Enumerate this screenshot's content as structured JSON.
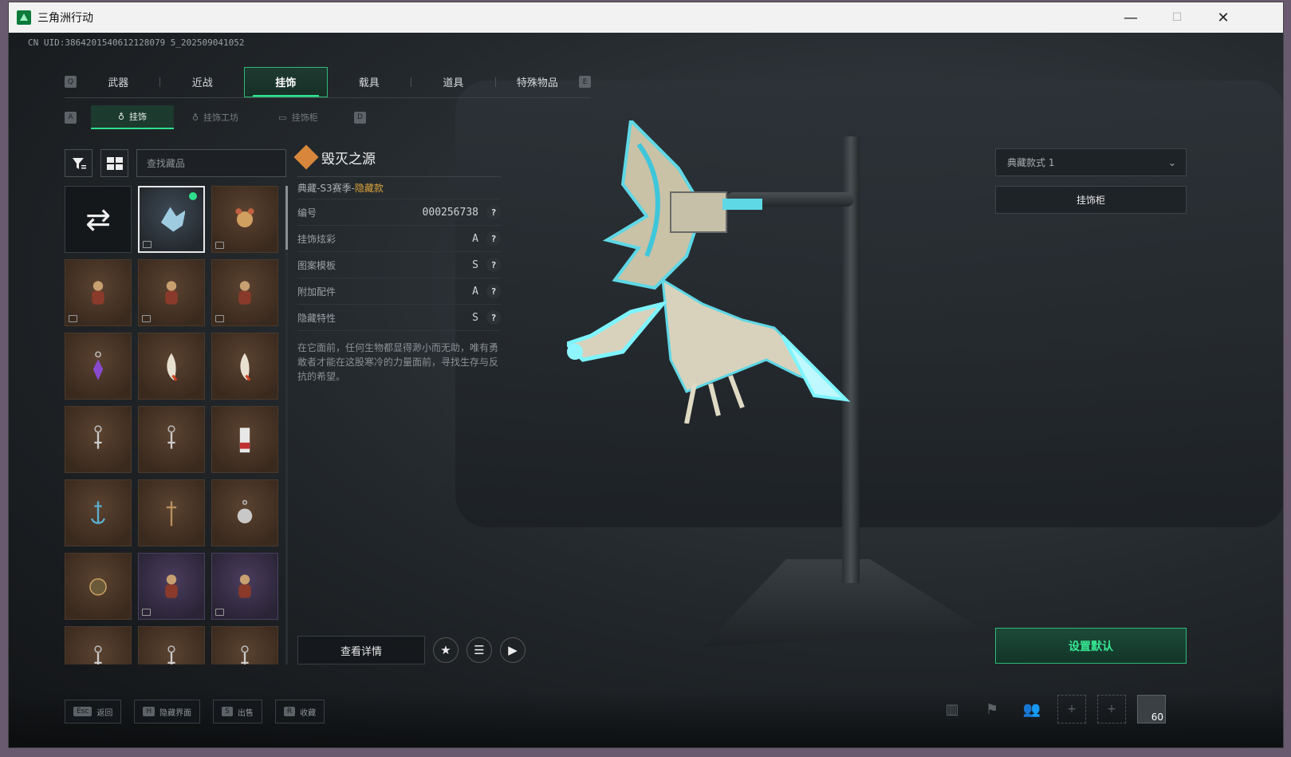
{
  "window": {
    "title": "三角洲行动",
    "minimize": "—",
    "maximize": "☐",
    "close": "✕"
  },
  "uid": "CN UID:3864201540612128079 5_202509041052",
  "tabs": {
    "left_key": "Q",
    "right_key": "E",
    "items": [
      "武器",
      "近战",
      "挂饰",
      "载具",
      "道具",
      "特殊物品"
    ],
    "active": "挂饰"
  },
  "subtabs": {
    "left_key": "A",
    "right_key": "D",
    "items": [
      "挂饰",
      "挂饰工坊",
      "挂饰柜"
    ],
    "active": "挂饰"
  },
  "search": {
    "placeholder": "查找藏品"
  },
  "grid": {
    "cells": [
      {
        "kind": "random"
      },
      {
        "kind": "selected",
        "equipped": true,
        "icon": "dragon-icon"
      },
      {
        "kind": "brown",
        "icon": "bear-icon"
      },
      {
        "kind": "brown",
        "icon": "figure-icon"
      },
      {
        "kind": "brown",
        "icon": "figure-icon"
      },
      {
        "kind": "brown",
        "icon": "figure-icon"
      },
      {
        "kind": "brown",
        "icon": "crystal-icon"
      },
      {
        "kind": "brown",
        "icon": "feather-icon"
      },
      {
        "kind": "brown",
        "icon": "feather-icon"
      },
      {
        "kind": "brown",
        "icon": "keychain-icon"
      },
      {
        "kind": "brown",
        "icon": "keychain-icon"
      },
      {
        "kind": "brown",
        "icon": "tag-icon"
      },
      {
        "kind": "brown",
        "icon": "anchor-icon"
      },
      {
        "kind": "brown",
        "icon": "cross-icon"
      },
      {
        "kind": "brown",
        "icon": "ball-icon"
      },
      {
        "kind": "brown",
        "icon": "medal-icon"
      },
      {
        "kind": "purple",
        "icon": "figure-icon"
      },
      {
        "kind": "purple",
        "icon": "figure-icon"
      },
      {
        "kind": "brown",
        "icon": "keychain-icon"
      },
      {
        "kind": "brown",
        "icon": "keychain-icon"
      },
      {
        "kind": "brown",
        "icon": "keychain-icon"
      }
    ]
  },
  "detail": {
    "name": "毁灭之源",
    "tier_prefix": "典藏-S3赛季-",
    "tier_hidden": "隐藏款",
    "rows": [
      {
        "label": "编号",
        "value": "000256738"
      },
      {
        "label": "挂饰炫彩",
        "value": "A"
      },
      {
        "label": "图案模板",
        "value": "S"
      },
      {
        "label": "附加配件",
        "value": "A"
      },
      {
        "label": "隐藏特性",
        "value": "S"
      }
    ],
    "help": "?",
    "description": "在它面前，任何生物都显得渺小而无助，唯有勇敢者才能在这股寒冷的力量面前，寻找生存与反抗的希望。"
  },
  "actions": {
    "view_details": "查看详情"
  },
  "right": {
    "style_select": "典藏款式 1",
    "cabinet": "挂饰柜",
    "set_default": "设置默认"
  },
  "hotkeys": [
    {
      "key": "Esc",
      "label": "返回"
    },
    {
      "key": "H",
      "label": "隐藏界面"
    },
    {
      "key": "S",
      "label": "出售"
    },
    {
      "key": "R",
      "label": "收藏"
    }
  ],
  "hud": {
    "level": "60",
    "add": "+"
  },
  "colors": {
    "accent": "#2fe08d",
    "hidden_tier": "#d9a43a",
    "ornament": "#6fe8f0"
  }
}
